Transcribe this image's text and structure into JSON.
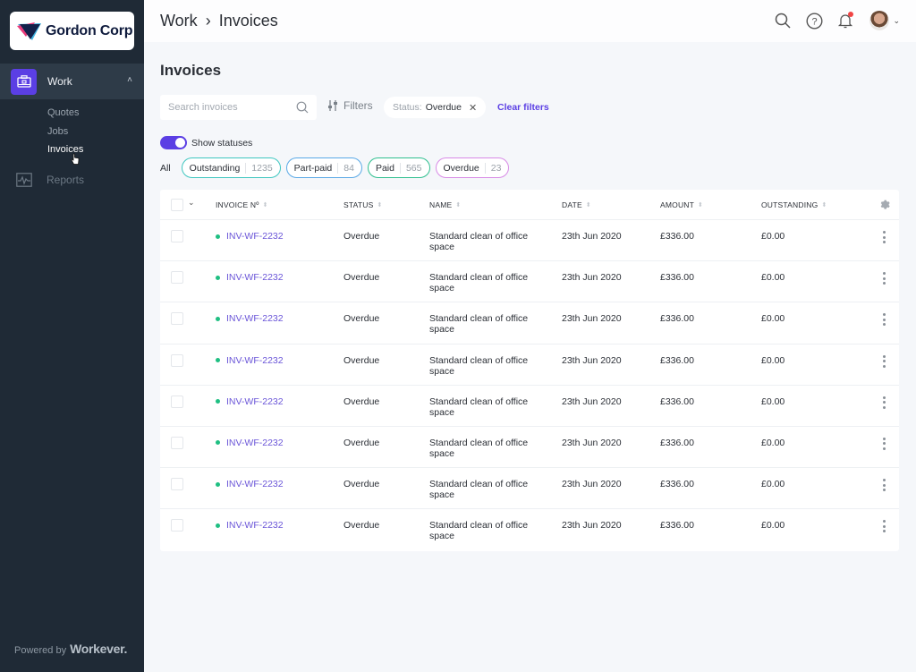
{
  "sidebar": {
    "brand": "Gordon Corp",
    "nav": {
      "work_label": "Work",
      "sub_items": [
        {
          "label": "Quotes",
          "active": false
        },
        {
          "label": "Jobs",
          "active": false
        },
        {
          "label": "Invoices",
          "active": true
        }
      ],
      "reports_label": "Reports"
    },
    "powered_by": "Powered by",
    "powered_brand": "Workever."
  },
  "header": {
    "breadcrumb": [
      "Work",
      "›",
      "Invoices"
    ],
    "icons": [
      "search-icon",
      "help-icon",
      "bell-icon",
      "avatar"
    ],
    "notification_dot_color": "#f04444"
  },
  "main": {
    "title": "Invoices",
    "search": {
      "placeholder": "Search invoices",
      "value": ""
    },
    "filters_label": "Filters",
    "active_filter": {
      "key": "Status:",
      "value": "Overdue"
    },
    "clear_filters_label": "Clear filters",
    "show_statuses_label": "Show statuses",
    "show_statuses_on": true,
    "status_pills": {
      "all_label": "All",
      "items": [
        {
          "name": "Outstanding",
          "count": "1235",
          "color": "#3fc7c0"
        },
        {
          "name": "Part-paid",
          "count": "84",
          "color": "#5aa9e6"
        },
        {
          "name": "Paid",
          "count": "565",
          "color": "#2fbf8f"
        },
        {
          "name": "Overdue",
          "count": "23",
          "color": "#d88ae6"
        }
      ]
    },
    "table": {
      "columns": [
        "INVOICE Nº",
        "STATUS",
        "NAME",
        "DATE",
        "AMOUNT",
        "OUTSTANDING"
      ],
      "rows": [
        {
          "invoice": "INV-WF-2232",
          "status": "Overdue",
          "name_line1": "Standard clean of office",
          "name_line2": "space",
          "date": "23th Jun 2020",
          "amount": "£336.00",
          "outstanding": "£0.00"
        },
        {
          "invoice": "INV-WF-2232",
          "status": "Overdue",
          "name_line1": "Standard clean of office",
          "name_line2": "space",
          "date": "23th Jun 2020",
          "amount": "£336.00",
          "outstanding": "£0.00"
        },
        {
          "invoice": "INV-WF-2232",
          "status": "Overdue",
          "name_line1": "Standard clean of office",
          "name_line2": "space",
          "date": "23th Jun 2020",
          "amount": "£336.00",
          "outstanding": "£0.00"
        },
        {
          "invoice": "INV-WF-2232",
          "status": "Overdue",
          "name_line1": "Standard clean of office",
          "name_line2": "space",
          "date": "23th Jun 2020",
          "amount": "£336.00",
          "outstanding": "£0.00"
        },
        {
          "invoice": "INV-WF-2232",
          "status": "Overdue",
          "name_line1": "Standard clean of office",
          "name_line2": "space",
          "date": "23th Jun 2020",
          "amount": "£336.00",
          "outstanding": "£0.00"
        },
        {
          "invoice": "INV-WF-2232",
          "status": "Overdue",
          "name_line1": "Standard clean of office",
          "name_line2": "space",
          "date": "23th Jun 2020",
          "amount": "£336.00",
          "outstanding": "£0.00"
        },
        {
          "invoice": "INV-WF-2232",
          "status": "Overdue",
          "name_line1": "Standard clean of office",
          "name_line2": "space",
          "date": "23th Jun 2020",
          "amount": "£336.00",
          "outstanding": "£0.00"
        },
        {
          "invoice": "INV-WF-2232",
          "status": "Overdue",
          "name_line1": "Standard clean of office",
          "name_line2": "space",
          "date": "23th Jun 2020",
          "amount": "£336.00",
          "outstanding": "£0.00"
        }
      ]
    }
  },
  "colors": {
    "accent": "#5b3fe4",
    "sidebar_bg": "#1f2a36",
    "status_dot": "#1fbf82",
    "link": "#6a55d8"
  }
}
